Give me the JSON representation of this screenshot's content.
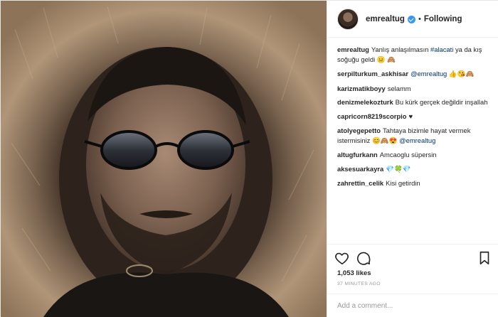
{
  "header": {
    "username": "emrealtug",
    "separator": "•",
    "follow_status": "Following"
  },
  "caption": {
    "user": "emrealtug",
    "text_before": "Yanlış anlaşılmasın ",
    "hashtag": "#alacati",
    "text_after": " ya da kış soğuğu geldi",
    "emoji": "😐 🙈"
  },
  "comments": [
    {
      "user": "serpilturkum_askhisar",
      "text": "",
      "mention": "@emrealtug",
      "emoji": " 👍😘🙈"
    },
    {
      "user": "karizmatikboyy",
      "text": "selamm",
      "mention": "",
      "emoji": ""
    },
    {
      "user": "denizmelekozturk",
      "text": "Bu kürk gerçek değildir inşallah",
      "mention": "",
      "emoji": ""
    },
    {
      "user": "capricorn8219scorpio",
      "text": "",
      "mention": "",
      "emoji": "♥"
    },
    {
      "user": "atolyegepetto",
      "text": "Tahtaya bizimle hayat vermek istermisiniz ",
      "mention": "@emrealtug",
      "emoji": "😊🙈😍 "
    },
    {
      "user": "altugfurkann",
      "text": "Amcaoglu süpersin",
      "mention": "",
      "emoji": ""
    },
    {
      "user": "aksesuarkayra",
      "text": "",
      "mention": "",
      "emoji": "💎🍀💎"
    },
    {
      "user": "zahrettin_celik",
      "text": "Kisi getirdin",
      "mention": "",
      "emoji": ""
    }
  ],
  "likes": "1,053 likes",
  "time_ago": "37 MINUTES AGO",
  "add_comment": {
    "placeholder": "Add a comment..."
  },
  "icons": {
    "like": "heart-icon",
    "comment": "comment-bubble-icon",
    "save": "bookmark-icon",
    "more": "more-options-icon"
  },
  "colors": {
    "verified": "#3897f0",
    "hashtag": "#003569",
    "muted": "#999999",
    "text": "#262626"
  }
}
